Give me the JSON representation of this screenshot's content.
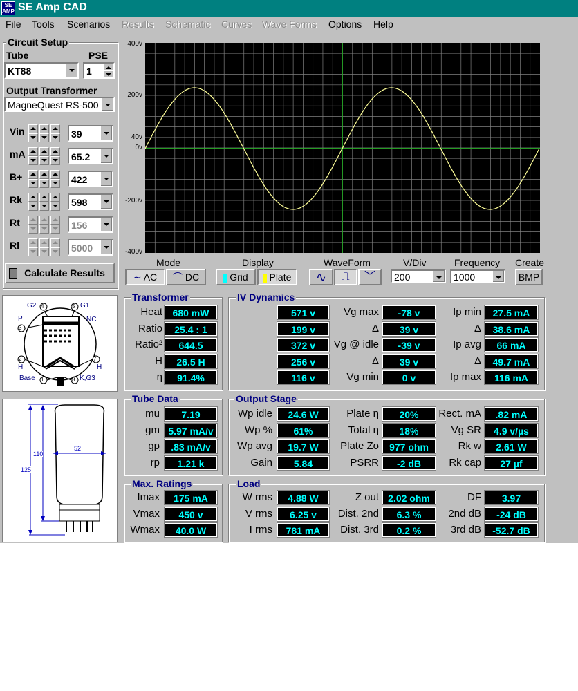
{
  "window": {
    "title": "SE Amp CAD",
    "icon_text": "SE AMP"
  },
  "menu": [
    "File",
    "Tools",
    "Scenarios",
    "Results",
    "Schematic",
    "Curves",
    "Wave Forms",
    "Options",
    "Help"
  ],
  "menu_disabled": [
    false,
    false,
    false,
    true,
    true,
    true,
    true,
    false,
    false
  ],
  "setup": {
    "title": "Circuit Setup",
    "tube_label": "Tube",
    "tube_value": "KT88",
    "pse_label": "PSE",
    "pse_value": "1",
    "ot_label": "Output Transformer",
    "ot_value": "MagneQuest RS-500",
    "params": [
      {
        "label": "Vin",
        "value": "39",
        "enabled": true
      },
      {
        "label": "mA",
        "value": "65.2",
        "enabled": true
      },
      {
        "label": "B+",
        "value": "422",
        "enabled": true
      },
      {
        "label": "Rk",
        "value": "598",
        "enabled": true
      },
      {
        "label": "Rt",
        "value": "156",
        "enabled": false
      },
      {
        "label": "Rl",
        "value": "5000",
        "enabled": false
      }
    ],
    "calc_button": "Calculate Results"
  },
  "scope": {
    "y_labels": [
      "400v",
      "200v",
      "40v",
      "0v",
      "-200v",
      "-400v"
    ],
    "grid_color": "#808080",
    "axis_color": "#00c000",
    "trace_color": "#ffff99"
  },
  "controls": {
    "mode_label": "Mode",
    "mode_ac": "AC",
    "mode_dc": "DC",
    "display_label": "Display",
    "display_grid": "Grid",
    "display_plate": "Plate",
    "waveform_label": "WaveForm",
    "vdiv_label": "V/Div",
    "vdiv_value": "200",
    "freq_label": "Frequency",
    "freq_value": "1000",
    "create_label": "Create",
    "create_button": "BMP"
  },
  "pinout": {
    "g2": "G2",
    "g1": "G1",
    "p": "P",
    "nc": "NC",
    "h1": "H",
    "h2": "H",
    "base": "Base",
    "kg3": "K,G3",
    "pins": [
      "4",
      "5",
      "3",
      "2",
      "7",
      "1",
      "8"
    ]
  },
  "dims": {
    "width": "52",
    "height1": "110",
    "height2": "125"
  },
  "transformer": {
    "title": "Transformer",
    "rows": [
      [
        "Heat",
        "680 mW"
      ],
      [
        "Ratio",
        "25.4 : 1"
      ],
      [
        "Ratio²",
        "644.5"
      ],
      [
        "H",
        "26.5 H"
      ],
      [
        "η",
        "91.4%"
      ]
    ]
  },
  "iv": {
    "title": "IV Dynamics",
    "col1": [
      [
        "Vp max",
        "571 v"
      ],
      [
        "Δ",
        "199 v"
      ],
      [
        "Vp avg",
        "372 v"
      ],
      [
        "Δ",
        "256 v"
      ],
      [
        "Vp min",
        "116 v"
      ]
    ],
    "col2": [
      [
        "Vg max",
        "-78 v"
      ],
      [
        "Δ",
        "39 v"
      ],
      [
        "Vg @ idle",
        "-39 v"
      ],
      [
        "Δ",
        "39 v"
      ],
      [
        "Vg min",
        "0 v"
      ]
    ],
    "col3": [
      [
        "Ip min",
        "27.5 mA"
      ],
      [
        "Δ",
        "38.6 mA"
      ],
      [
        "Ip avg",
        "66 mA"
      ],
      [
        "Δ",
        "49.7 mA"
      ],
      [
        "Ip max",
        "116 mA"
      ]
    ]
  },
  "tube_data": {
    "title": "Tube Data",
    "rows": [
      [
        "mu",
        "7.19"
      ],
      [
        "gm",
        "5.97 mA/v"
      ],
      [
        "gp",
        ".83 mA/v"
      ],
      [
        "rp",
        "1.21 k"
      ]
    ]
  },
  "output_stage": {
    "title": "Output Stage",
    "col1": [
      [
        "Wp idle",
        "24.6 W"
      ],
      [
        "Wp %",
        "61%"
      ],
      [
        "Wp avg",
        "19.7 W"
      ],
      [
        "Gain",
        "5.84"
      ]
    ],
    "col2": [
      [
        "Plate η",
        "20%"
      ],
      [
        "Total η",
        "18%"
      ],
      [
        "Plate Zo",
        "977 ohm"
      ],
      [
        "PSRR",
        "-2 dB"
      ]
    ],
    "col3": [
      [
        "Rect. mA",
        ".82 mA"
      ],
      [
        "Vg SR",
        "4.9 v/µs"
      ],
      [
        "Rk w",
        "2.61 W"
      ],
      [
        "Rk cap",
        "27 µf"
      ]
    ]
  },
  "max_ratings": {
    "title": "Max. Ratings",
    "rows": [
      [
        "Imax",
        "175 mA"
      ],
      [
        "Vmax",
        "450 v"
      ],
      [
        "Wmax",
        "40.0 W"
      ]
    ]
  },
  "load": {
    "title": "Load",
    "col1": [
      [
        "W rms",
        "4.88 W"
      ],
      [
        "V rms",
        "6.25 v"
      ],
      [
        "I rms",
        "781 mA"
      ]
    ],
    "col2": [
      [
        "Z out",
        "2.02 ohm"
      ],
      [
        "Dist. 2nd",
        "6.3 %"
      ],
      [
        "Dist. 3rd",
        "0.2 %"
      ]
    ],
    "col3": [
      [
        "DF",
        "3.97"
      ],
      [
        "2nd dB",
        "-24 dB"
      ],
      [
        "3rd dB",
        "-52.7 dB"
      ]
    ]
  }
}
